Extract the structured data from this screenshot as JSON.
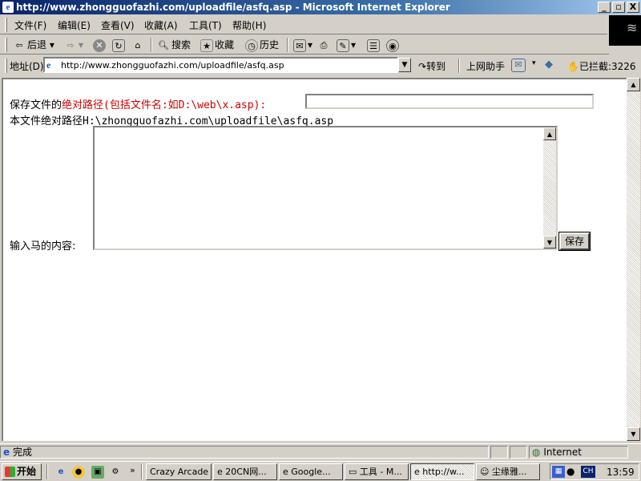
{
  "window": {
    "title": "http://www.zhongguofazhi.com/uploadfile/asfq.asp - Microsoft Internet Explorer",
    "controls": {
      "minimize": "_",
      "maximize": "▫",
      "close": "X"
    }
  },
  "menu": [
    "文件(F)",
    "编辑(E)",
    "查看(V)",
    "收藏(A)",
    "工具(T)",
    "帮助(H)"
  ],
  "toolbar": {
    "back": "后退",
    "search": "搜索",
    "favorites": "收藏",
    "history": "历史"
  },
  "address_bar": {
    "label": "地址(D)",
    "url": "http://www.zhongguofazhi.com/uploadfile/asfq.asp",
    "go": "转到",
    "assistant": "上网助手",
    "blocked": "已拦截:3226"
  },
  "page": {
    "save_label_prefix": "保存文件的",
    "save_label_red": "绝对路径(包括文件名:如D:\\web\\x.asp):",
    "path_input_value": "",
    "file_path_line": "本文件绝对路径H:\\zhongguofazhi.com\\uploadfile\\asfq.asp",
    "content_label": "输入马的内容:",
    "content_value": "",
    "save_button": "保存"
  },
  "status": {
    "text": "完成",
    "zone": "Internet"
  },
  "taskbar": {
    "start": "开始",
    "tasks": [
      "Crazy Arcade",
      "20CN网...",
      "Google...",
      "工具 - M...",
      "http://w...",
      "尘缘雅..."
    ],
    "active_task_index": 4,
    "tray_lang": "CH",
    "clock": "13:59"
  }
}
